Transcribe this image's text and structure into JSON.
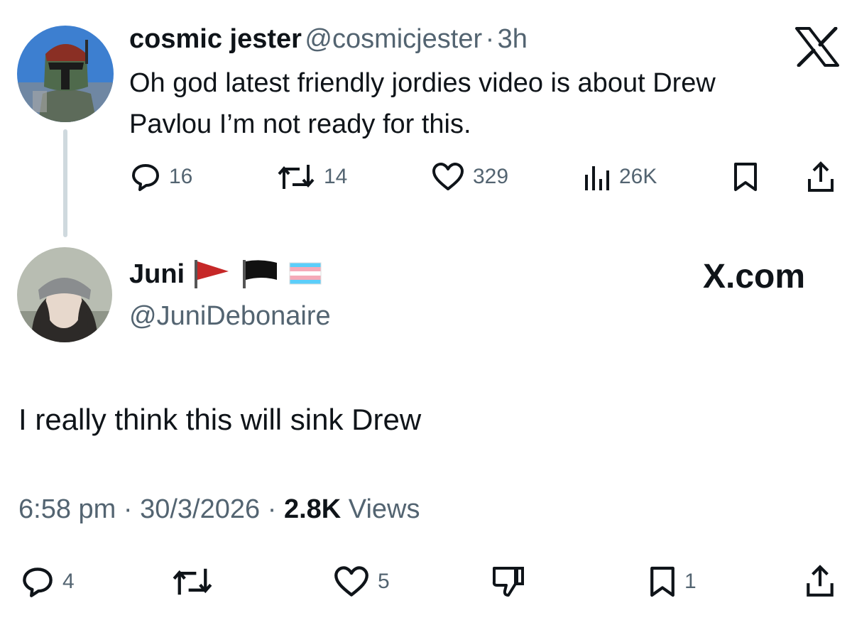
{
  "tweet1": {
    "display_name": "cosmic jester",
    "handle": "@cosmicjester",
    "separator": "·",
    "time_ago": "3h",
    "text_line1": "Oh god latest friendly jordies video is about Drew",
    "text_line2": "Pavlou I’m not ready for this.",
    "actions": {
      "replies": "16",
      "reposts": "14",
      "likes": "329",
      "views": "26K"
    }
  },
  "tweet2": {
    "display_name": "Juni",
    "handle": "@JuniDebonaire",
    "text": "I really think this will sink Drew",
    "time": "6:58 pm",
    "date": "30/3/2026",
    "separator": "·",
    "views_count": "2.8K",
    "views_label": "Views",
    "actions": {
      "replies": "4",
      "likes": "5",
      "bookmarks": "1"
    }
  },
  "branding": {
    "xcom": "X.com"
  },
  "colors": {
    "text": "#0f1419",
    "muted": "#536471",
    "thread_line": "#cfd9de"
  },
  "icons": [
    "x-logo-icon",
    "reply-icon",
    "repost-icon",
    "like-icon",
    "views-icon",
    "bookmark-icon",
    "share-icon",
    "dislike-icon",
    "red-flag-icon",
    "black-flag-icon",
    "trans-flag-icon"
  ]
}
